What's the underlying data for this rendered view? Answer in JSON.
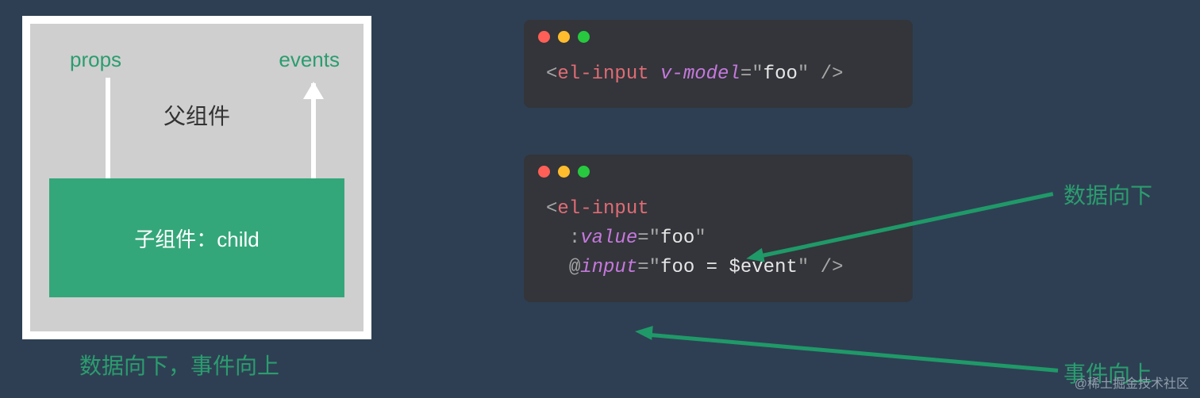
{
  "diagram": {
    "props_label": "props",
    "events_label": "events",
    "parent_label": "父组件",
    "child_label": "子组件：child",
    "caption": "数据向下，事件向上"
  },
  "code1": {
    "open": "<",
    "tag": "el-input",
    "attr": "v-model",
    "eq": "=",
    "q1": "\"",
    "val": "foo",
    "q2": "\"",
    "close": " />"
  },
  "code2": {
    "open": "<",
    "tag": "el-input",
    "attr1_prefix": ":",
    "attr1": "value",
    "eq": "=",
    "q": "\"",
    "val1": "foo",
    "attr2_prefix": "@",
    "attr2": "input",
    "val2": "foo = $event",
    "close": " />"
  },
  "annotations": {
    "data_down": "数据向下",
    "event_up": "事件向上"
  },
  "watermark": "@稀土掘金技术社区"
}
